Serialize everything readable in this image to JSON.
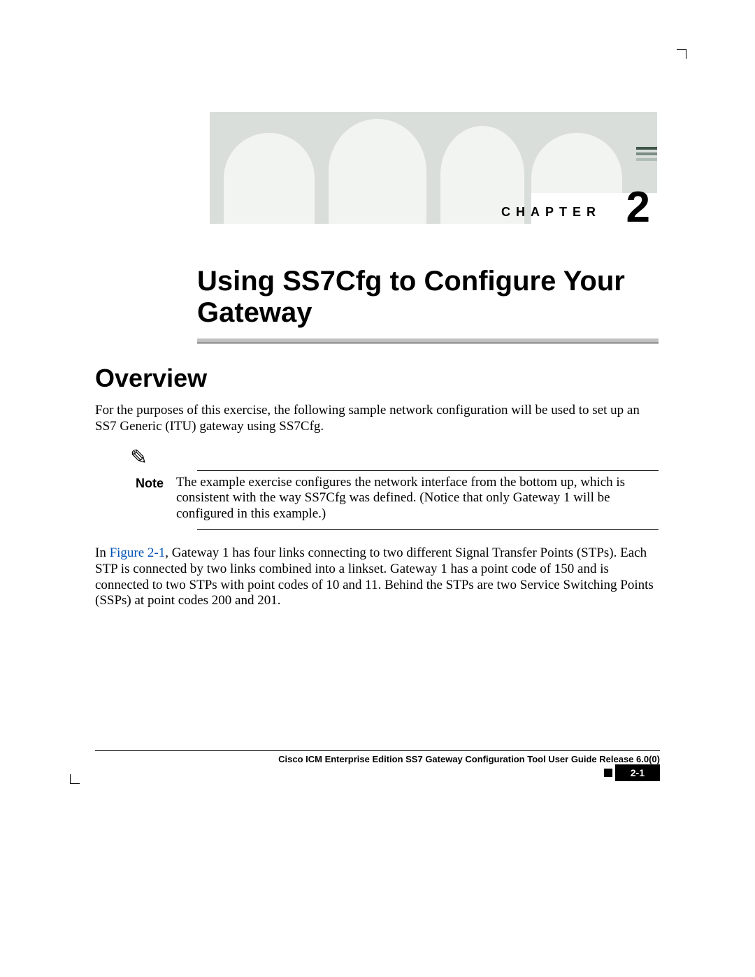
{
  "chapter": {
    "label": "CHAPTER",
    "number": "2"
  },
  "title": "Using SS7Cfg to Configure Your Gateway",
  "section_heading": "Overview",
  "paragraphs": {
    "intro": "For the purposes of this exercise, the following sample network configuration will be used to set up an SS7 Generic (ITU) gateway using SS7Cfg.",
    "note_label": "Note",
    "note_body": "The example exercise configures the network interface from the bottom up, which is consistent with the way SS7Cfg was defined. (Notice that only Gateway 1 will be configured in this example.)",
    "p2_prefix": "In ",
    "p2_link": "Figure 2-1",
    "p2_rest": ", Gateway 1 has four links connecting to two different Signal Transfer Points (STPs). Each STP is connected by two links combined into a linkset. Gateway 1 has a point code of 150 and is connected to two STPs with point codes of 10 and 11. Behind the STPs are two Service Switching Points (SSPs) at point codes 200 and 201."
  },
  "footer": {
    "book": "Cisco ICM Enterprise Edition SS7 Gateway Configuration Tool User Guide Release 6.0(0)",
    "page": "2-1"
  }
}
